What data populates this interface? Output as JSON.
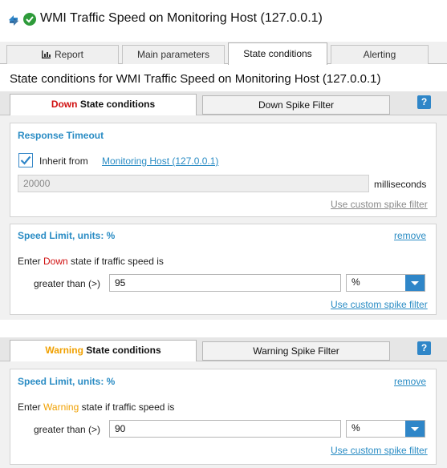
{
  "window": {
    "title": "WMI Traffic Speed on Monitoring Host (127.0.0.1)"
  },
  "tabs": [
    {
      "label": "Report"
    },
    {
      "label": "Main parameters"
    },
    {
      "label": "State conditions"
    },
    {
      "label": "Alerting"
    }
  ],
  "heading": "State conditions for WMI Traffic Speed on Monitoring Host (127.0.0.1)",
  "down": {
    "tab_state_word": "Down",
    "tab_rest": " State conditions",
    "spike_tab": "Down Spike Filter",
    "help": "?",
    "response_timeout": {
      "title": "Response Timeout",
      "inherit_label": "Inherit from",
      "inherit_link": "Monitoring Host (127.0.0.1)",
      "value": "20000",
      "unit": "milliseconds",
      "spike_link": "Use custom spike filter"
    },
    "speed_limit": {
      "title": "Speed Limit, units: %",
      "remove": "remove",
      "enter_prefix": "Enter ",
      "enter_state": "Down",
      "enter_suffix": " state if traffic speed is",
      "comparator": "greater than (>)",
      "value": "95",
      "unit": "%",
      "spike_link": "Use custom spike filter"
    }
  },
  "warning": {
    "tab_state_word": "Warning",
    "tab_rest": " State conditions",
    "spike_tab": "Warning Spike Filter",
    "help": "?",
    "speed_limit": {
      "title": "Speed Limit, units: %",
      "remove": "remove",
      "enter_prefix": "Enter ",
      "enter_state": "Warning",
      "enter_suffix": " state if traffic speed is",
      "comparator": "greater than (>)",
      "value": "90",
      "unit": "%",
      "spike_link": "Use custom spike filter"
    }
  },
  "colors": {
    "accent": "#2f86c8",
    "link": "#2a8cc4",
    "down": "#d01010",
    "warning": "#f0a000",
    "ok": "#2e9b3a"
  },
  "icons": [
    "sync-icon",
    "ok-status-icon",
    "report-chart-icon",
    "help-icon",
    "checkmark-icon",
    "chevron-down-icon"
  ]
}
